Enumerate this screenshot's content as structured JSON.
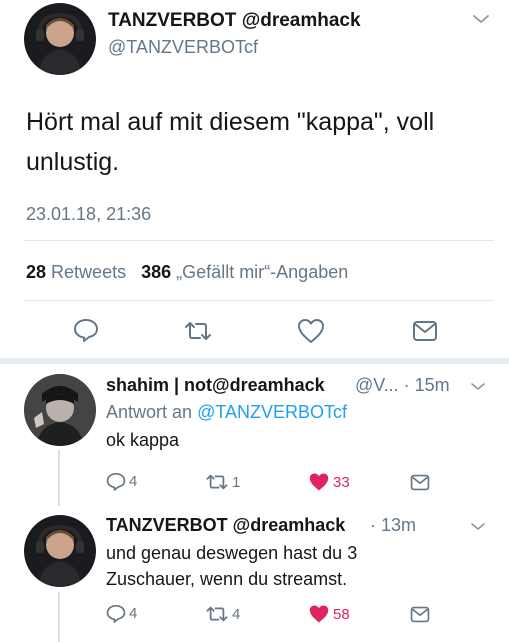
{
  "tweet": {
    "display_name": "TANZVERBOT @dreamhack",
    "handle": "@TANZVERBOTcf",
    "text": "Hört mal auf mit diesem \"kappa\", voll unlustig.",
    "timestamp": "23.01.18, 21:36",
    "retweet_count": "28",
    "retweet_label": "Retweets",
    "like_count": "386",
    "like_label": "„Gefällt mir“-Angaben"
  },
  "replies": [
    {
      "display_name": "shahim | not@dreamhack",
      "meta": "@V... · 15m",
      "reply_to_label": "Antwort an",
      "reply_to_handle": "@TANZVERBOTcf",
      "text": "ok kappa",
      "reply_count": "4",
      "retweet_count": "1",
      "like_count": "33"
    },
    {
      "display_name": "TANZVERBOT @dreamhack",
      "meta": "· 13m",
      "text": "und genau deswegen hast du  3 Zuschauer, wenn du streamst.",
      "reply_count": "4",
      "retweet_count": "4",
      "like_count": "58"
    }
  ],
  "icons": {
    "reply": "speech-bubble-icon",
    "retweet": "retweet-icon",
    "like": "heart-icon",
    "message": "envelope-icon",
    "caret": "chevron-down-icon"
  },
  "colors": {
    "link": "#1da1f2",
    "like_active": "#e0245e",
    "muted": "#657786",
    "text": "#14171a"
  }
}
